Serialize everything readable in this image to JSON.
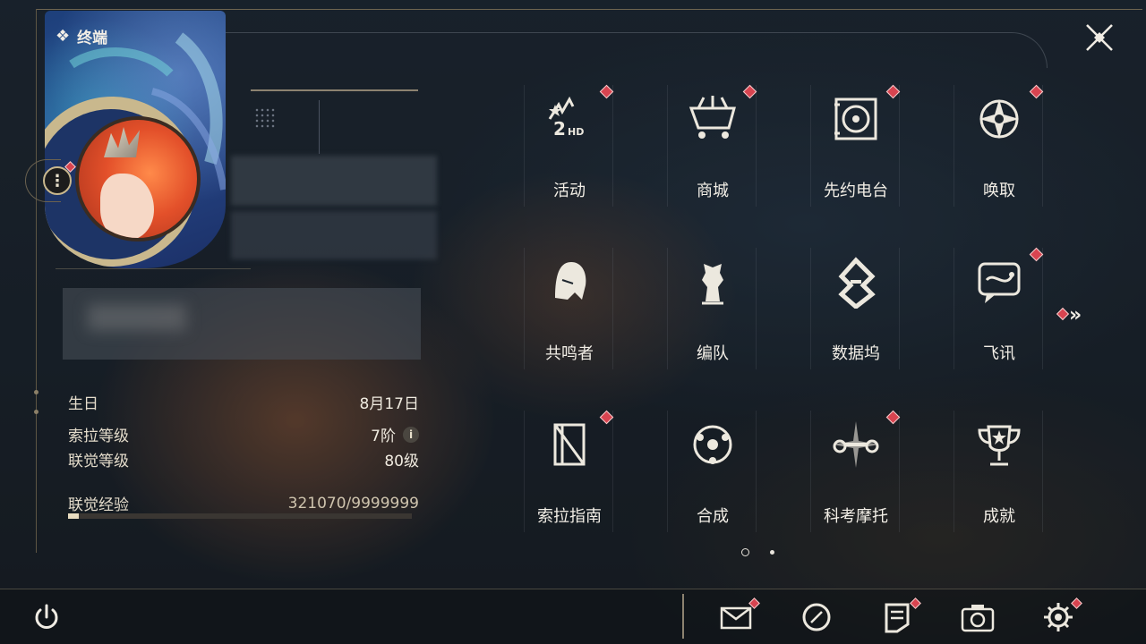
{
  "header": {
    "title": "终端",
    "close_icon": "close-x-icon"
  },
  "profile": {
    "more_icon": "more-vertical-icon",
    "info": [
      {
        "key": "生日",
        "value": "8月17日"
      },
      {
        "key": "索拉等级",
        "value": "7阶"
      },
      {
        "key": "联觉等级",
        "value": "80级"
      }
    ],
    "exp": {
      "key": "联觉经验",
      "value": "321070/9999999",
      "progress": 0.032
    }
  },
  "menu": {
    "items": [
      {
        "label": "活动",
        "icon": "event-2nd-anniversary-icon",
        "badge": true
      },
      {
        "label": "商城",
        "icon": "shop-cart-icon",
        "badge": true
      },
      {
        "label": "先约电台",
        "icon": "radio-record-player-icon",
        "badge": true
      },
      {
        "label": "唤取",
        "icon": "summon-compass-icon",
        "badge": true
      },
      {
        "label": "共鸣者",
        "icon": "resonator-portrait-icon",
        "badge": false
      },
      {
        "label": "编队",
        "icon": "team-chess-icon",
        "badge": false
      },
      {
        "label": "数据坞",
        "icon": "data-bank-icon",
        "badge": false
      },
      {
        "label": "飞讯",
        "icon": "message-chat-icon",
        "badge": true
      },
      {
        "label": "索拉指南",
        "icon": "guidebook-icon",
        "badge": true
      },
      {
        "label": "合成",
        "icon": "synthesis-orbit-icon",
        "badge": false
      },
      {
        "label": "科考摩托",
        "icon": "motorcycle-icon",
        "badge": true
      },
      {
        "label": "成就",
        "icon": "achievement-trophy-icon",
        "badge": false
      }
    ],
    "next_page_icon": "double-chevron-right-icon",
    "pagination": {
      "current": 1,
      "total": 2
    }
  },
  "bottom_bar": {
    "power_icon": "power-icon",
    "items": [
      {
        "icon": "mail-icon",
        "badge": true
      },
      {
        "icon": "clock-icon",
        "badge": false
      },
      {
        "icon": "notice-icon",
        "badge": true
      },
      {
        "icon": "camera-icon",
        "badge": false
      },
      {
        "icon": "settings-gear-icon",
        "badge": true
      }
    ]
  },
  "colors": {
    "accent_gold": "#c9b88d",
    "badge_red": "#d84450",
    "text": "#f2eee6"
  }
}
